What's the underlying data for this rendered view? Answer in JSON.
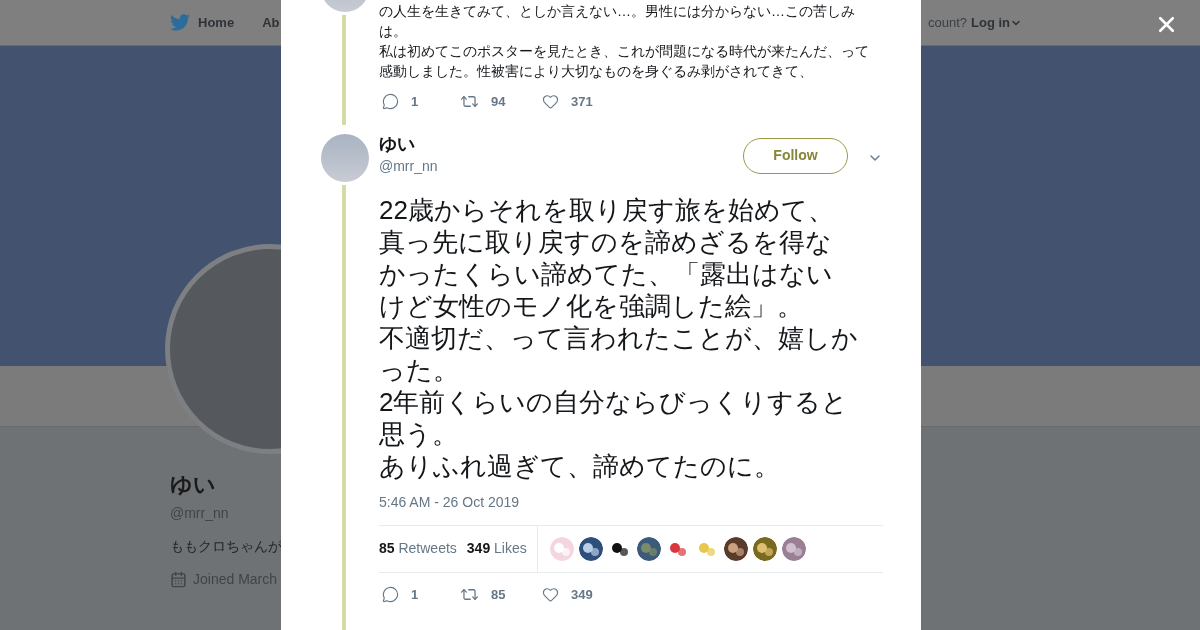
{
  "nav": {
    "home": "Home",
    "about": "Ab",
    "account": "count?",
    "login": "Log in"
  },
  "profile": {
    "name": "ゆい",
    "handle": "@mrr_nn",
    "bio": "ももクロちゃんが",
    "joined": "Joined March"
  },
  "previous_tweet": {
    "lines": [
      "の人生を生きてみて、としか言えない…。男性には分からない…この苦しみ",
      "は。",
      "私は初めてこのポスターを見たとき、これが問題になる時代が来たんだ、って",
      "感動しました。性被害により大切なものを身ぐるみ剥がされてきて、"
    ],
    "replies": "1",
    "retweets": "94",
    "likes": "371"
  },
  "tweet": {
    "name": "ゆい",
    "handle": "@mrr_nn",
    "follow": "Follow",
    "lines": [
      "22歳からそれを取り戻す旅を始めて、",
      "真っ先に取り戻すのを諦めざるを得な",
      "かったくらい諦めてた、「露出はない",
      "けど女性のモノ化を強調した絵」。",
      "不適切だ、って言われたことが、嬉しか",
      "った。",
      "2年前くらいの自分ならびっくりすると",
      "思う。",
      "ありふれ過ぎて、諦めてたのに。"
    ],
    "timestamp": "5:46 AM - 26 Oct 2019",
    "retweet_count": "85",
    "retweet_label": "Retweets",
    "like_count": "349",
    "like_label": "Likes",
    "replies": "1",
    "retweets": "85",
    "likes": "349"
  }
}
